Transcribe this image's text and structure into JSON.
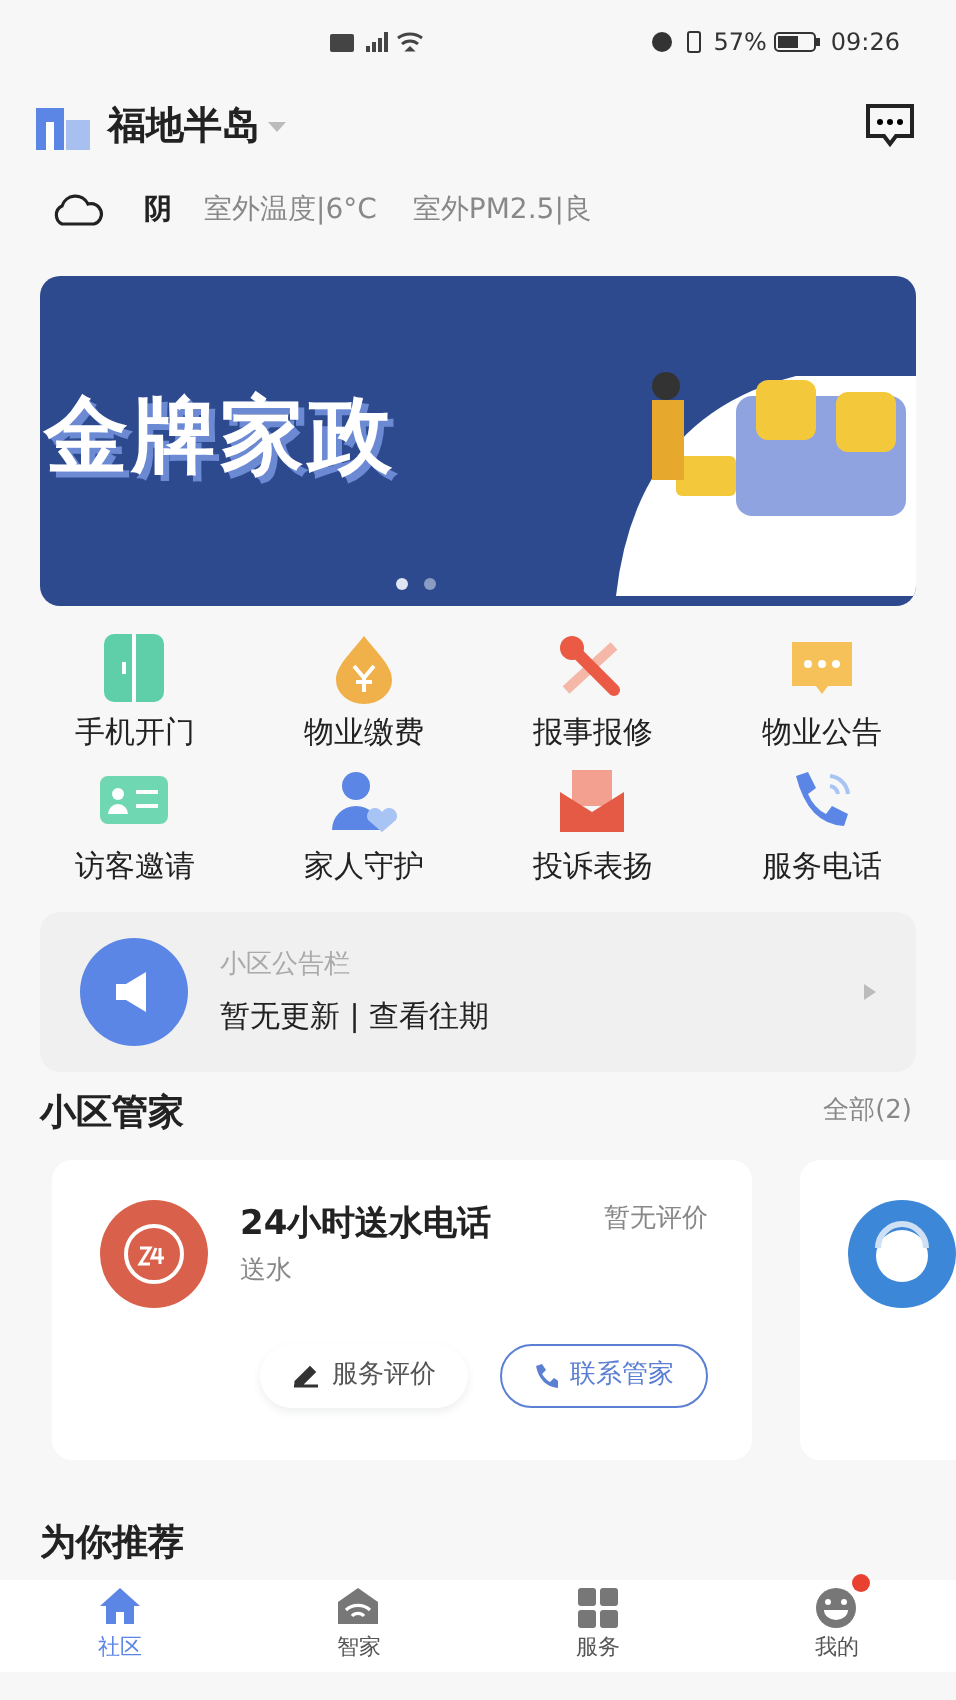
{
  "status_bar": {
    "battery": "57%",
    "time": "09:26"
  },
  "header": {
    "community": "福地半岛"
  },
  "weather": {
    "condition": "阴",
    "temperature": "室外温度|6°C",
    "pm": "室外PM2.5|良"
  },
  "banner": {
    "title": "金牌家政",
    "dots": [
      {
        "selected": true
      },
      {
        "selected": false
      }
    ]
  },
  "services": [
    {
      "label": "手机开门",
      "kind": "door"
    },
    {
      "label": "物业缴费",
      "kind": "pay"
    },
    {
      "label": "报事报修",
      "kind": "repair"
    },
    {
      "label": "物业公告",
      "kind": "notice"
    },
    {
      "label": "访客邀请",
      "kind": "visitor"
    },
    {
      "label": "家人守护",
      "kind": "family"
    },
    {
      "label": "投诉表扬",
      "kind": "mail"
    },
    {
      "label": "服务电话",
      "kind": "phone"
    }
  ],
  "notice_board": {
    "title": "小区公告栏",
    "text": "暂无更新 | 查看往期"
  },
  "stewards": {
    "title": "小区管家",
    "all": "全部(2)",
    "cards": [
      {
        "name": "24小时送水电话",
        "tag": "送水",
        "rating": "暂无评价",
        "rate_button": "服务评价",
        "contact_button": "联系管家"
      }
    ]
  },
  "recommend": {
    "title": "为你推荐"
  },
  "tab_bar": [
    {
      "label": "社区",
      "kind": "home",
      "selected": true,
      "badge": false
    },
    {
      "label": "智家",
      "kind": "smart",
      "selected": false,
      "badge": false
    },
    {
      "label": "服务",
      "kind": "grid",
      "selected": false,
      "badge": false
    },
    {
      "label": "我的",
      "kind": "face",
      "selected": false,
      "badge": true
    }
  ]
}
